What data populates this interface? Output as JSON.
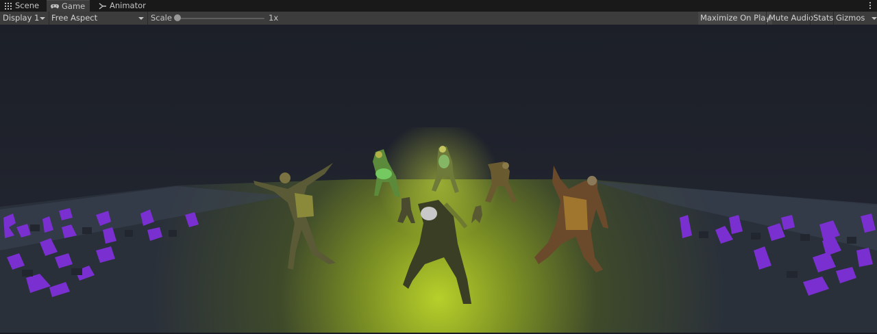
{
  "tabs": [
    {
      "label": "Scene",
      "icon": "grid-icon"
    },
    {
      "label": "Game",
      "icon": "gamepad-icon"
    },
    {
      "label": "Animator",
      "icon": "animator-icon"
    }
  ],
  "toolbar": {
    "display": "Display 1",
    "aspect": "Free Aspect",
    "scale_label": "Scale",
    "scale_value": "1x",
    "maximize": "Maximize On Play",
    "mute": "Mute Audio",
    "stats": "Stats",
    "gizmos": "Gizmos"
  },
  "colors": {
    "spotlight": "#c8e030",
    "purple": "#7a2fd1",
    "background": "#1f222b"
  }
}
